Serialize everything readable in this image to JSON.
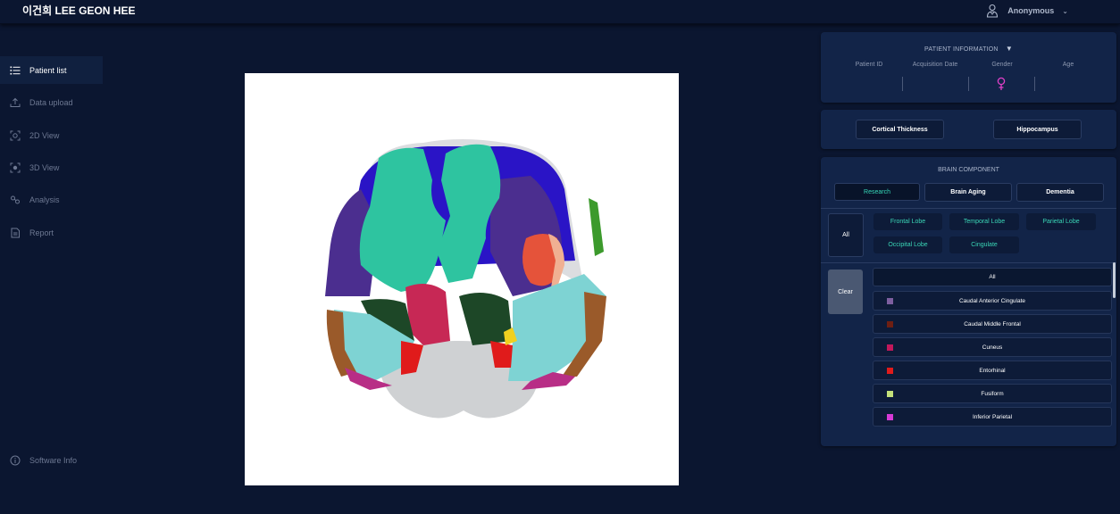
{
  "header": {
    "title": "이건희 LEE GEON HEE",
    "user": "Anonymous"
  },
  "sidebar": {
    "items": [
      {
        "label": "Patient list",
        "icon": "list-icon",
        "active": true
      },
      {
        "label": "Data upload",
        "icon": "upload-icon"
      },
      {
        "label": "2D View",
        "icon": "scan-2d-icon"
      },
      {
        "label": "3D View",
        "icon": "scan-3d-icon"
      },
      {
        "label": "Analysis",
        "icon": "analysis-icon"
      },
      {
        "label": "Report",
        "icon": "report-icon"
      }
    ],
    "software_info": "Software Info"
  },
  "patient_info": {
    "title": "PATIENT INFORMATION",
    "columns": [
      "Patient ID",
      "Acquisition Date",
      "Gender",
      "Age"
    ],
    "gender_icon": "female-icon",
    "gender_color": "#e040c8"
  },
  "analysis_buttons": {
    "cortical": "Cortical Thickness",
    "hippocampus": "Hippocampus"
  },
  "brain_component": {
    "title": "BRAIN COMPONENT",
    "tabs": [
      "Research",
      "Brain Aging",
      "Dementia"
    ],
    "active_tab": "Research",
    "all_label": "All",
    "lobes": [
      "Frontal Lobe",
      "Temporal Lobe",
      "Parietal Lobe",
      "Occipital Lobe",
      "Cingulate"
    ],
    "clear_label": "Clear",
    "components_all": "All",
    "components": [
      {
        "name": "Caudal Anterior Cingulate",
        "color": "#7d5fa0"
      },
      {
        "name": "Caudal Middle Frontal",
        "color": "#6e1f12"
      },
      {
        "name": "Cuneus",
        "color": "#c2185b"
      },
      {
        "name": "Entorhinal",
        "color": "#e01b1b"
      },
      {
        "name": "Fusiform",
        "color": "#c4e07a"
      },
      {
        "name": "Inferior Parietal",
        "color": "#d63ad6"
      }
    ]
  },
  "colors": {
    "background": "#0b1630",
    "panel": "#122448",
    "accent": "#36d7b7"
  }
}
